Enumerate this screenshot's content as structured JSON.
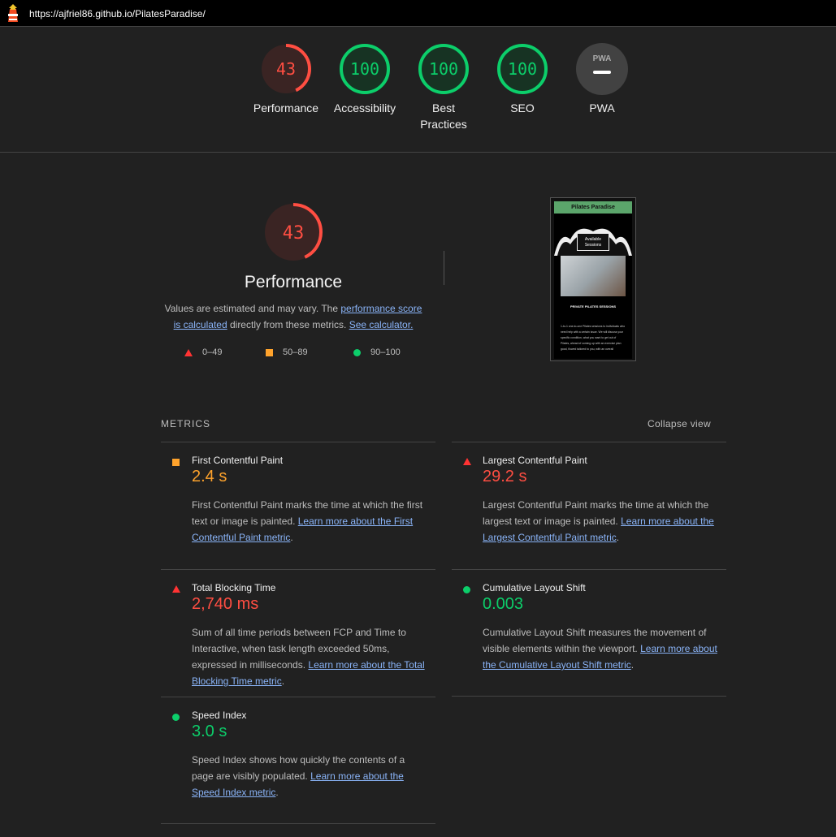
{
  "url": "https://ajfriel86.github.io/PilatesParadise/",
  "colors": {
    "fail": "#ff4e42",
    "average": "#ffa32c",
    "pass": "#0cce6a",
    "link": "#8ab4f8"
  },
  "gauges": [
    {
      "score": "43",
      "label": "Performance",
      "status": "fail",
      "fraction": 0.43
    },
    {
      "score": "100",
      "label": "Accessibility",
      "status": "pass",
      "fraction": 1.0
    },
    {
      "score": "100",
      "label": "Best Practices",
      "status": "pass",
      "fraction": 1.0
    },
    {
      "score": "100",
      "label": "SEO",
      "status": "pass",
      "fraction": 1.0
    },
    {
      "score": "",
      "label": "PWA",
      "status": "na",
      "fraction": 0
    }
  ],
  "pwa_badge": "PWA",
  "performance": {
    "score": "43",
    "fraction": 0.43,
    "title": "Performance",
    "desc_prefix": "Values are estimated and may vary. The ",
    "link1": "performance score is calculated",
    "desc_middle": " directly from these metrics. ",
    "link2": "See calculator.",
    "legend": [
      "0–49",
      "50–89",
      "90–100"
    ]
  },
  "thumbnail": {
    "header": "Pilates Paradise",
    "button": "Available Sessions",
    "caption": "PRIVATE PILATES SESSIONS",
    "text": "1-to-1 one-to-one Pilates sessions to individuals who need help with a certain issue. We will discuss your specific condition, what you want to get out of Pilates, ahead of coming up with an exercise plan good, flowed tailored to you, with an overall"
  },
  "metrics_label": "METRICS",
  "collapse_label": "Collapse view",
  "metrics": [
    {
      "title": "First Contentful Paint",
      "value": "2.4 s",
      "status": "average",
      "desc": "First Contentful Paint marks the time at which the first text or image is painted. ",
      "link": "Learn more about the First Contentful Paint metric",
      "end": "."
    },
    {
      "title": "Largest Contentful Paint",
      "value": "29.2 s",
      "status": "fail",
      "desc": "Largest Contentful Paint marks the time at which the largest text or image is painted. ",
      "link": "Learn more about the Largest Contentful Paint metric",
      "end": "."
    },
    {
      "title": "Total Blocking Time",
      "value": "2,740 ms",
      "status": "fail",
      "desc": "Sum of all time periods between FCP and Time to Interactive, when task length exceeded 50ms, expressed in milliseconds. ",
      "link": "Learn more about the Total Blocking Time metric",
      "end": "."
    },
    {
      "title": "Cumulative Layout Shift",
      "value": "0.003",
      "status": "pass",
      "desc": "Cumulative Layout Shift measures the movement of visible elements within the viewport. ",
      "link": "Learn more about the Cumulative Layout Shift metric",
      "end": "."
    },
    {
      "title": "Speed Index",
      "value": "3.0 s",
      "status": "pass",
      "desc": "Speed Index shows how quickly the contents of a page are visibly populated. ",
      "link": "Learn more about the Speed Index metric",
      "end": "."
    }
  ]
}
